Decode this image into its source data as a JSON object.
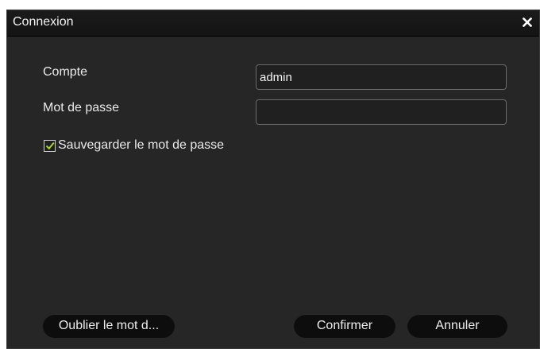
{
  "dialog": {
    "title": "Connexion",
    "close_icon": "close-icon"
  },
  "form": {
    "account_label": "Compte",
    "account_value": "admin",
    "password_label": "Mot de passe",
    "password_value": "",
    "save_password_label": "Sauvegarder le mot de passe",
    "save_password_checked": true
  },
  "buttons": {
    "forgot_label": "Oublier le mot d...",
    "confirm_label": "Confirmer",
    "cancel_label": "Annuler"
  },
  "colors": {
    "dialog_bg": "#262626",
    "titlebar_bg": "#161616",
    "check_accent": "#a6d63c",
    "button_bg": "#0d0d0d"
  }
}
